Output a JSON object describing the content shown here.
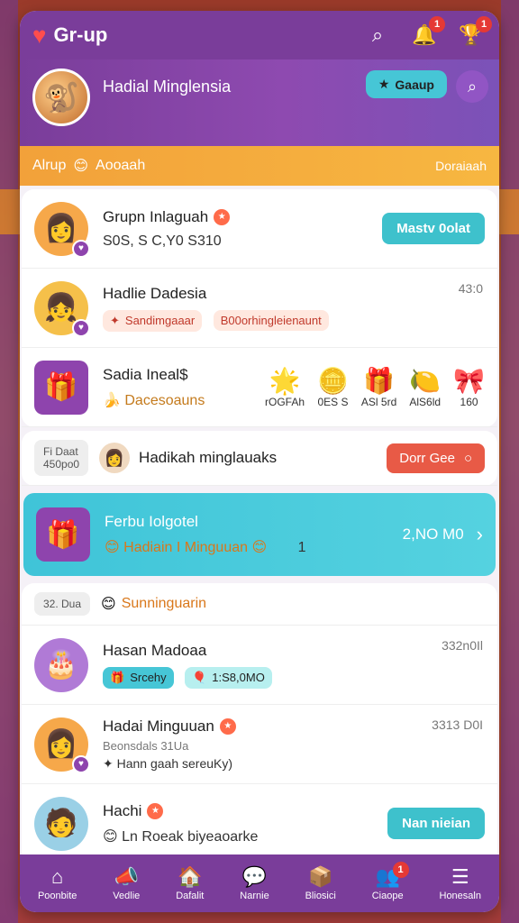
{
  "app": {
    "title": "Gr-up",
    "notification_badge": "1",
    "trophy_badge": "1"
  },
  "hero": {
    "name": "Hadial Minglensia",
    "group_button": "Gaaup",
    "strip_left": "Alrup",
    "strip_left_secondary": "Aooaah",
    "strip_right": "Doraiaah"
  },
  "rows": [
    {
      "name": "Grupn Inlaguah",
      "subtitle": "S0S, S C,Y0 S310",
      "action_label": "Mastv 0olat"
    },
    {
      "name": "Hadlie Dadesia",
      "time": "43:0",
      "pill_left": "Sandimgaaar",
      "pill_right": "B00orhingleienaunt"
    },
    {
      "name": "Sadia Ineal$",
      "subtitle": "Dacesoauns",
      "gifts": [
        {
          "icon": "sun-icon",
          "label": "rOGFAh"
        },
        {
          "icon": "coin-icon",
          "label": "0ES S"
        },
        {
          "icon": "gift-icon",
          "label": "ASl 5rd"
        },
        {
          "icon": "lemon-icon",
          "label": "AlS6ld"
        },
        {
          "icon": "present-icon",
          "label": "160"
        }
      ]
    }
  ],
  "section": {
    "tag_line1": "Fi Daat",
    "tag_line2": "450po0",
    "name": "Hadikah minglauaks",
    "action_label": "Dorr Gee"
  },
  "highlight": {
    "title": "Ferbu Iolgotel",
    "subtitle": "Hadiain I Minguuan",
    "value": "2,NO M0",
    "pin": "1"
  },
  "group2": {
    "tag": "32. Dua",
    "title": "Sunninguarin"
  },
  "rows2": [
    {
      "name": "Hasan Madoaa",
      "time": "332n0Il",
      "pill_left": "Srcehy",
      "pill_right": "1:S8,0MO"
    },
    {
      "name": "Hadai Minguuan",
      "time": "3313 D0I",
      "subtitle": "Beonsdals 31Ua",
      "line": "Hann gaah sereuKy)"
    },
    {
      "name": "Hachi",
      "subtitle": "Roeak biyeaoarke",
      "prefix": "Ln",
      "action_label": "Nan nieian"
    }
  ],
  "nav": [
    {
      "label": "Poonbite",
      "icon": "home-icon"
    },
    {
      "label": "Vedlie",
      "icon": "megaphone-icon"
    },
    {
      "label": "Dafalit",
      "icon": "shop-icon"
    },
    {
      "label": "Narnie",
      "icon": "chat-icon"
    },
    {
      "label": "Bliosici",
      "icon": "box-icon"
    },
    {
      "label": "Ciaope",
      "icon": "user-icon",
      "badge": "1"
    },
    {
      "label": "Honesaln",
      "icon": "menu-icon"
    }
  ]
}
